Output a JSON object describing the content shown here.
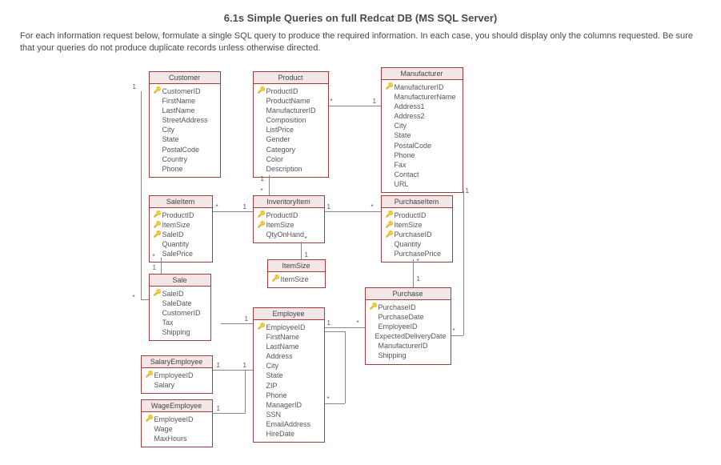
{
  "title": "6.1s Simple Queries on full Redcat DB (MS SQL Server)",
  "intro": "For each information request below, formulate a single SQL query to produce the required information.  In each case, you should display only the columns requested.  Be sure that your queries do not produce duplicate records unless otherwise directed.",
  "entities": {
    "customer": {
      "name": "Customer",
      "fields": [
        {
          "k": 1,
          "n": "CustomerID"
        },
        {
          "k": 0,
          "n": "FirstName"
        },
        {
          "k": 0,
          "n": "LastName"
        },
        {
          "k": 0,
          "n": "StreetAddress"
        },
        {
          "k": 0,
          "n": "City"
        },
        {
          "k": 0,
          "n": "State"
        },
        {
          "k": 0,
          "n": "PostalCode"
        },
        {
          "k": 0,
          "n": "Country"
        },
        {
          "k": 0,
          "n": "Phone"
        }
      ]
    },
    "product": {
      "name": "Product",
      "fields": [
        {
          "k": 1,
          "n": "ProductID"
        },
        {
          "k": 0,
          "n": "ProductName"
        },
        {
          "k": 0,
          "n": "ManufacturerID"
        },
        {
          "k": 0,
          "n": "Composition"
        },
        {
          "k": 0,
          "n": "ListPrice"
        },
        {
          "k": 0,
          "n": "Gender"
        },
        {
          "k": 0,
          "n": "Category"
        },
        {
          "k": 0,
          "n": "Color"
        },
        {
          "k": 0,
          "n": "Description"
        }
      ]
    },
    "manufacturer": {
      "name": "Manufacturer",
      "fields": [
        {
          "k": 1,
          "n": "ManufacturerID"
        },
        {
          "k": 0,
          "n": "ManufacturerName"
        },
        {
          "k": 0,
          "n": "Address1"
        },
        {
          "k": 0,
          "n": "Address2"
        },
        {
          "k": 0,
          "n": "City"
        },
        {
          "k": 0,
          "n": "State"
        },
        {
          "k": 0,
          "n": "PostalCode"
        },
        {
          "k": 0,
          "n": "Phone"
        },
        {
          "k": 0,
          "n": "Fax"
        },
        {
          "k": 0,
          "n": "Contact"
        },
        {
          "k": 0,
          "n": "URL"
        }
      ]
    },
    "saleitem": {
      "name": "SaleItem",
      "fields": [
        {
          "k": 1,
          "n": "ProductID"
        },
        {
          "k": 1,
          "n": "ItemSize"
        },
        {
          "k": 1,
          "n": "SaleID"
        },
        {
          "k": 0,
          "n": "Quantity"
        },
        {
          "k": 0,
          "n": "SalePrice"
        }
      ]
    },
    "inventoryitem": {
      "name": "InventoryItem",
      "fields": [
        {
          "k": 1,
          "n": "ProductID"
        },
        {
          "k": 1,
          "n": "ItemSize"
        },
        {
          "k": 0,
          "n": "QtyOnHand"
        }
      ]
    },
    "purchaseitem": {
      "name": "PurchaseItem",
      "fields": [
        {
          "k": 1,
          "n": "ProductID"
        },
        {
          "k": 1,
          "n": "ItemSize"
        },
        {
          "k": 1,
          "n": "PurchaseID"
        },
        {
          "k": 0,
          "n": "Quantity"
        },
        {
          "k": 0,
          "n": "PurchasePrice"
        }
      ]
    },
    "itemsize": {
      "name": "ItemSize",
      "fields": [
        {
          "k": 1,
          "n": "ItemSize"
        }
      ]
    },
    "sale": {
      "name": "Sale",
      "fields": [
        {
          "k": 1,
          "n": "SaleID"
        },
        {
          "k": 0,
          "n": "SaleDate"
        },
        {
          "k": 0,
          "n": "CustomerID"
        },
        {
          "k": 0,
          "n": "Tax"
        },
        {
          "k": 0,
          "n": "Shipping"
        }
      ]
    },
    "purchase": {
      "name": "Purchase",
      "fields": [
        {
          "k": 1,
          "n": "PurchaseID"
        },
        {
          "k": 0,
          "n": "PurchaseDate"
        },
        {
          "k": 0,
          "n": "EmployeeID"
        },
        {
          "k": 0,
          "n": "ExpectedDeliveryDate"
        },
        {
          "k": 0,
          "n": "ManufacturerID"
        },
        {
          "k": 0,
          "n": "Shipping"
        }
      ]
    },
    "employee": {
      "name": "Employee",
      "fields": [
        {
          "k": 1,
          "n": "EmployeeID"
        },
        {
          "k": 0,
          "n": "FirstName"
        },
        {
          "k": 0,
          "n": "LastName"
        },
        {
          "k": 0,
          "n": "Address"
        },
        {
          "k": 0,
          "n": "City"
        },
        {
          "k": 0,
          "n": "State"
        },
        {
          "k": 0,
          "n": "ZIP"
        },
        {
          "k": 0,
          "n": "Phone"
        },
        {
          "k": 0,
          "n": "ManagerID"
        },
        {
          "k": 0,
          "n": "SSN"
        },
        {
          "k": 0,
          "n": "EmailAddress"
        },
        {
          "k": 0,
          "n": "HireDate"
        }
      ]
    },
    "salaryemployee": {
      "name": "SalaryEmployee",
      "fields": [
        {
          "k": 1,
          "n": "EmployeeID"
        },
        {
          "k": 0,
          "n": "Salary"
        }
      ]
    },
    "wageemployee": {
      "name": "WageEmployee",
      "fields": [
        {
          "k": 1,
          "n": "EmployeeID"
        },
        {
          "k": 0,
          "n": "Wage"
        },
        {
          "k": 0,
          "n": "MaxHours"
        }
      ]
    }
  },
  "chart_data": {
    "type": "erd",
    "relationships": [
      {
        "from": "Customer",
        "to": "Sale",
        "card": [
          "1",
          "*"
        ]
      },
      {
        "from": "Sale",
        "to": "SaleItem",
        "card": [
          "1",
          "*"
        ]
      },
      {
        "from": "Product",
        "to": "SaleItem",
        "card": [
          "1",
          "*"
        ]
      },
      {
        "from": "Product",
        "to": "InventoryItem",
        "card": [
          "1",
          "*"
        ]
      },
      {
        "from": "Product",
        "to": "PurchaseItem",
        "card": [
          "1",
          "*"
        ]
      },
      {
        "from": "Manufacturer",
        "to": "Product",
        "card": [
          "1",
          "*"
        ]
      },
      {
        "from": "Manufacturer",
        "to": "Purchase",
        "card": [
          "1",
          "*"
        ]
      },
      {
        "from": "InventoryItem",
        "to": "SaleItem",
        "card": [
          "1",
          "*"
        ]
      },
      {
        "from": "InventoryItem",
        "to": "PurchaseItem",
        "card": [
          "1",
          "*"
        ]
      },
      {
        "from": "ItemSize",
        "to": "InventoryItem",
        "card": [
          "1",
          "*"
        ]
      },
      {
        "from": "Purchase",
        "to": "PurchaseItem",
        "card": [
          "1",
          "*"
        ]
      },
      {
        "from": "Employee",
        "to": "Purchase",
        "card": [
          "1",
          "*"
        ]
      },
      {
        "from": "Employee",
        "to": "Sale",
        "card": [
          "1",
          "*"
        ]
      },
      {
        "from": "Employee",
        "to": "Employee",
        "card": [
          "1",
          "*"
        ],
        "via": "ManagerID"
      },
      {
        "from": "Employee",
        "to": "SalaryEmployee",
        "card": [
          "1",
          "1"
        ]
      },
      {
        "from": "Employee",
        "to": "WageEmployee",
        "card": [
          "1",
          "1"
        ]
      }
    ]
  }
}
